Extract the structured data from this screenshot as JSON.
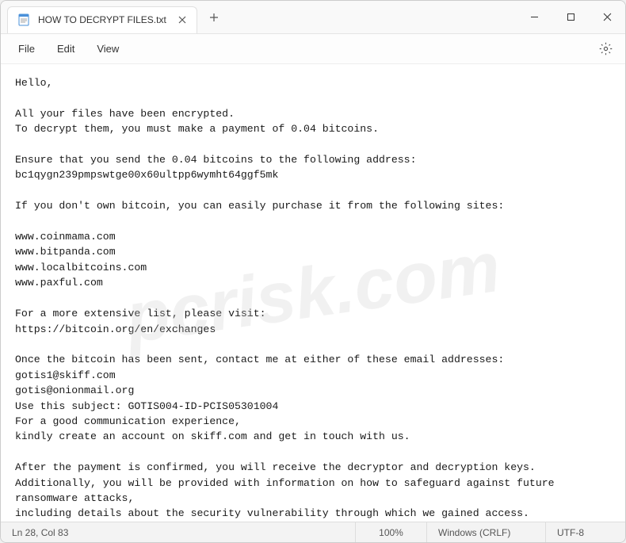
{
  "tab": {
    "title": "HOW TO DECRYPT FILES.txt"
  },
  "menu": {
    "file": "File",
    "edit": "Edit",
    "view": "View"
  },
  "content": {
    "text": "Hello,\n\nAll your files have been encrypted.\nTo decrypt them, you must make a payment of 0.04 bitcoins.\n\nEnsure that you send the 0.04 bitcoins to the following address:\nbc1qygn239pmpswtge00x60ultpp6wymht64ggf5mk\n\nIf you don't own bitcoin, you can easily purchase it from the following sites:\n\nwww.coinmama.com\nwww.bitpanda.com\nwww.localbitcoins.com\nwww.paxful.com\n\nFor a more extensive list, please visit:\nhttps://bitcoin.org/en/exchanges\n\nOnce the bitcoin has been sent, contact me at either of these email addresses:\ngotis1@skiff.com\ngotis@onionmail.org\nUse this subject: GOTIS004-ID-PCIS05301004\nFor a good communication experience,\nkindly create an account on skiff.com and get in touch with us.\n\nAfter the payment is confirmed, you will receive the decryptor and decryption keys.\nAdditionally, you will be provided with information on how to safeguard against future ransomware attacks,\nincluding details about the security vulnerability through which we gained access."
  },
  "status": {
    "position": "Ln 28, Col 83",
    "zoom": "100%",
    "lineEnding": "Windows (CRLF)",
    "encoding": "UTF-8"
  },
  "watermark": "pcrisk.com"
}
